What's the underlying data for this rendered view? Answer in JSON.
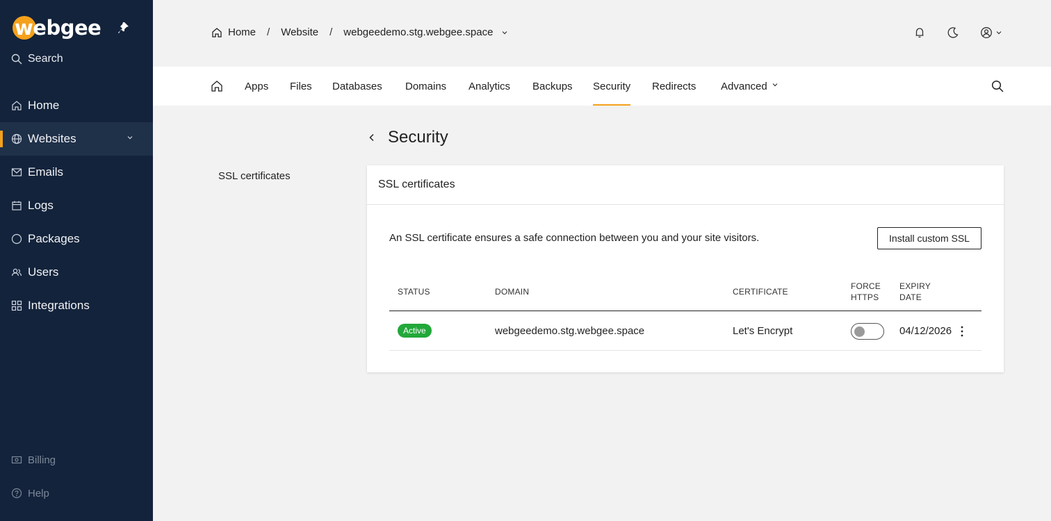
{
  "brand": {
    "name": "webgee",
    "accent": "#f5a11c",
    "sidebar_bg": "#13233b"
  },
  "sidebar": {
    "search_label": "Search",
    "items": [
      {
        "label": "Home",
        "icon": "home-icon"
      },
      {
        "label": "Websites",
        "icon": "globe-icon",
        "active": true
      },
      {
        "label": "Emails",
        "icon": "mail-icon"
      },
      {
        "label": "Logs",
        "icon": "calendar-icon"
      },
      {
        "label": "Packages",
        "icon": "circle-icon"
      },
      {
        "label": "Users",
        "icon": "users-icon"
      },
      {
        "label": "Integrations",
        "icon": "grid-icon"
      }
    ],
    "footer": [
      {
        "label": "Billing",
        "icon": "billing-icon"
      },
      {
        "label": "Help",
        "icon": "help-icon"
      }
    ]
  },
  "breadcrumb": {
    "items": [
      "Home",
      "Website",
      "webgeedemo.stg.webgee.space"
    ],
    "separator": "/"
  },
  "tabs": {
    "items": [
      "Apps",
      "Files",
      "Databases",
      "Domains",
      "Analytics",
      "Backups",
      "Security",
      "Redirects",
      "Advanced"
    ],
    "active": "Security"
  },
  "page": {
    "title": "Security",
    "side_links": [
      "SSL certificates"
    ]
  },
  "ssl_card": {
    "title": "SSL certificates",
    "description": "An SSL certificate ensures a safe connection between you and your site visitors.",
    "install_button": "Install custom SSL",
    "columns": [
      "STATUS",
      "DOMAIN",
      "CERTIFICATE",
      "FORCE",
      "HTTPS",
      "EXPIRY",
      "DATE"
    ],
    "rows": [
      {
        "status": "Active",
        "status_color": "#22a83a",
        "domain": "webgeedemo.stg.webgee.space",
        "certificate": "Let's Encrypt",
        "force_https": false,
        "expiry": "04/12/2026"
      }
    ]
  }
}
